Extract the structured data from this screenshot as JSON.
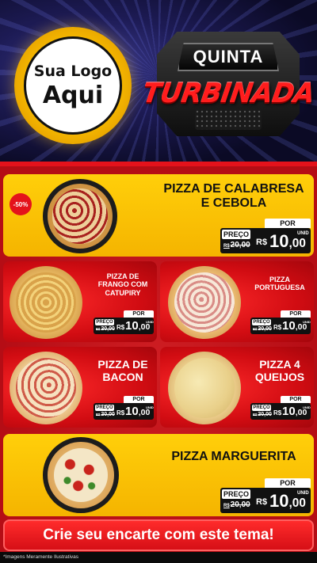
{
  "header": {
    "logo_line1": "Sua Logo",
    "logo_line2": "Aqui",
    "badge_top": "QUINTA",
    "badge_main": "TURBINADA"
  },
  "products": [
    {
      "id": "calabresa",
      "title_lines": [
        "PIZZA DE CALABRESA",
        "E CEBOLA"
      ],
      "discount": "-50%",
      "por": "POR",
      "preco": "PREÇO",
      "old_prefix": "R$",
      "old_price": "20,00",
      "currency": "R$",
      "price_int": "10",
      "price_dec": ",00",
      "unid": "UNID"
    },
    {
      "id": "frango",
      "title_lines": [
        "PIZZA DE",
        "FRANGO COM",
        "CATUPIRY"
      ],
      "por": "POR",
      "preco": "PREÇO",
      "old_prefix": "R$",
      "old_price": "20,00",
      "currency": "R$",
      "price_int": "10",
      "price_dec": ",00",
      "unid": "UNID"
    },
    {
      "id": "portuguesa",
      "title_lines": [
        "PIZZA",
        "PORTUGUESA"
      ],
      "por": "POR",
      "preco": "PREÇO",
      "old_prefix": "R$",
      "old_price": "20,00",
      "currency": "R$",
      "price_int": "10",
      "price_dec": ",00",
      "unid": "UNID"
    },
    {
      "id": "bacon",
      "title_lines": [
        "PIZZA DE",
        "BACON"
      ],
      "por": "POR",
      "preco": "PREÇO",
      "old_prefix": "R$",
      "old_price": "20,00",
      "currency": "R$",
      "price_int": "10",
      "price_dec": ",00",
      "unid": "UNID"
    },
    {
      "id": "queijos",
      "title_lines": [
        "PIZZA 4",
        "QUEIJOS"
      ],
      "por": "POR",
      "preco": "PREÇO",
      "old_prefix": "R$",
      "old_price": "20,00",
      "currency": "R$",
      "price_int": "10",
      "price_dec": ",00",
      "unid": "UNID"
    },
    {
      "id": "marguerita",
      "title_lines": [
        "PIZZA MARGUERITA"
      ],
      "por": "POR",
      "preco": "PREÇO",
      "old_prefix": "R$",
      "old_price": "20,00",
      "currency": "R$",
      "price_int": "10",
      "price_dec": ",00",
      "unid": "UNID"
    }
  ],
  "cta": "Crie seu encarte com este tema!",
  "footnote": "*Imagens Meramente Ilustrativas",
  "colors": {
    "yellow": "#f5b400",
    "red": "#d10c12",
    "dark": "#111111"
  }
}
